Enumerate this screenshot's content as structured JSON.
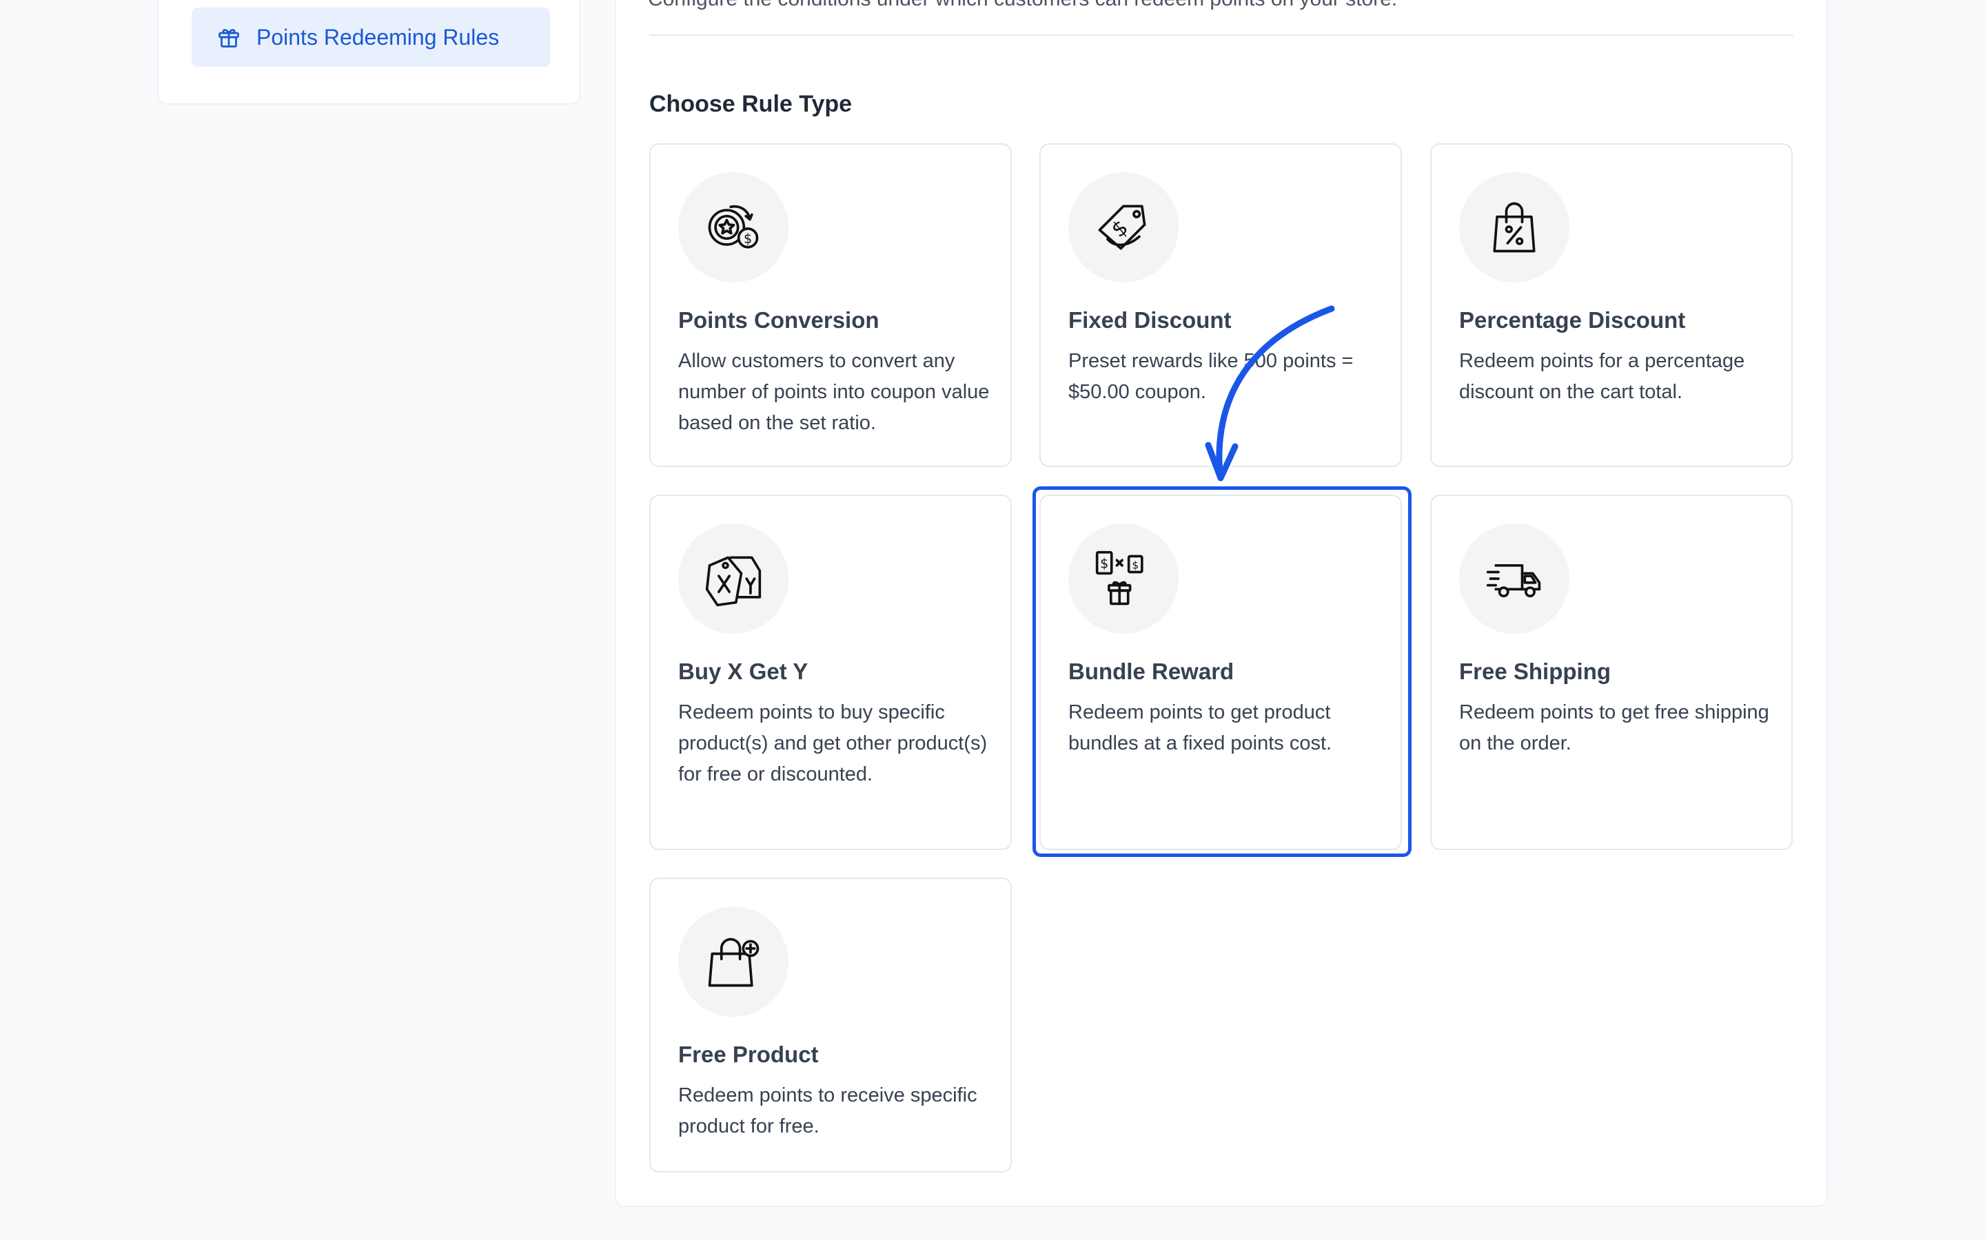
{
  "sidebar": {
    "items": [
      {
        "label": "Points Redeeming Rules",
        "icon": "gift-icon",
        "active": true
      }
    ]
  },
  "main": {
    "subtitle": "Configure the conditions under which customers can redeem points on your store.",
    "section_title": "Choose Rule Type",
    "rule_types": [
      {
        "title": "Points Conversion",
        "description": "Allow customers to convert any number of points into coupon value based on the set ratio.",
        "icon": "points-conversion-icon"
      },
      {
        "title": "Fixed Discount",
        "description": "Preset rewards like 500 points = $50.00 coupon.",
        "icon": "dollar-tag-icon"
      },
      {
        "title": "Percentage Discount",
        "description": "Redeem points for a percentage discount on the cart total.",
        "icon": "percent-bag-icon"
      },
      {
        "title": "Buy X Get Y",
        "description": "Redeem points to buy specific product(s) and get other product(s) for free or discounted.",
        "icon": "xy-tags-icon"
      },
      {
        "title": "Bundle Reward",
        "description": "Redeem points to get product bundles at a fixed points cost.",
        "icon": "bundle-icon",
        "highlighted": true
      },
      {
        "title": "Free Shipping",
        "description": "Redeem points to get free shipping on the order.",
        "icon": "truck-icon"
      },
      {
        "title": "Free Product",
        "description": "Redeem points to receive specific product for free.",
        "icon": "bag-plus-icon"
      }
    ]
  },
  "colors": {
    "accent": "#1a56e8",
    "active_bg": "#e8f0fd",
    "active_text": "#1959d2"
  }
}
